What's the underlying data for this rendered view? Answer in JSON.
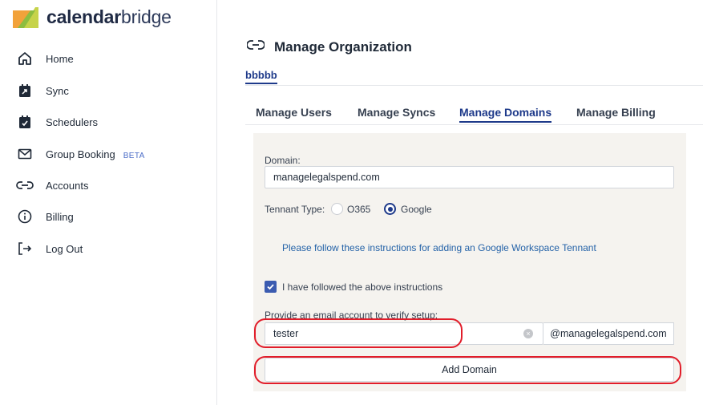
{
  "brand": {
    "name_bold": "calendar",
    "name_light": "bridge"
  },
  "sidebar": {
    "items": [
      {
        "label": "Home",
        "icon": "home-icon"
      },
      {
        "label": "Sync",
        "icon": "sync-calendar-icon"
      },
      {
        "label": "Schedulers",
        "icon": "scheduler-calendar-icon"
      },
      {
        "label": "Group Booking",
        "icon": "mail-icon",
        "badge": "BETA"
      },
      {
        "label": "Accounts",
        "icon": "link-icon"
      },
      {
        "label": "Billing",
        "icon": "info-icon"
      },
      {
        "label": "Log Out",
        "icon": "logout-icon"
      }
    ]
  },
  "main": {
    "title": "Manage Organization",
    "org_name": "bbbbb",
    "tabs": [
      {
        "label": "Manage Users"
      },
      {
        "label": "Manage Syncs"
      },
      {
        "label": "Manage Domains",
        "active": true
      },
      {
        "label": "Manage Billing"
      }
    ]
  },
  "form": {
    "domain_label": "Domain:",
    "domain_value": "managelegalspend.com",
    "tenant_label": "Tennant Type:",
    "tenant_options": [
      {
        "label": "O365",
        "checked": false
      },
      {
        "label": "Google",
        "checked": true
      }
    ],
    "instructions_link": "Please follow these instructions for adding an Google Workspace Tennant",
    "confirm_checkbox_label": "I have followed the above instructions",
    "confirm_checked": true,
    "email_label": "Provide an email account to verify setup:",
    "email_value": "tester",
    "email_suffix": "@managelegalspend.com",
    "add_button": "Add Domain"
  },
  "colors": {
    "accent": "#1e3a8a",
    "link": "#2563a8",
    "panel_bg": "#f5f3ef",
    "annotation": "#e11d2a"
  }
}
